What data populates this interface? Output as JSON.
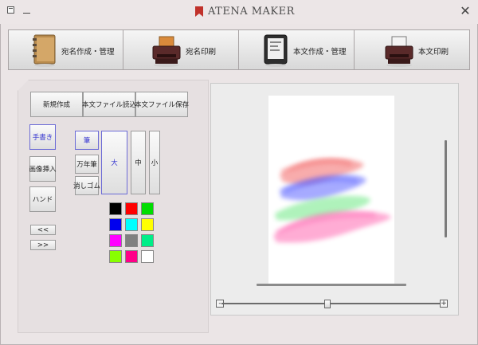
{
  "app": {
    "title": "ATENA MAKER",
    "close_glyph": "✕"
  },
  "top_tabs": [
    {
      "label": "宛名作成・管理",
      "icon": "address-book-icon"
    },
    {
      "label": "宛名印刷",
      "icon": "printer-icon"
    },
    {
      "label": "本文作成・管理",
      "icon": "tablet-document-icon"
    },
    {
      "label": "本文印刷",
      "icon": "printer-icon"
    }
  ],
  "file_buttons": {
    "new": "新規作成",
    "load": "本文ファイル読込",
    "save": "本文ファイル保存"
  },
  "mode_buttons": {
    "handwriting": "手書き",
    "insert_image": "画像挿入",
    "hand": "ハンド"
  },
  "nav_buttons": {
    "prev": "<<",
    "next": ">>"
  },
  "tools": {
    "brush": "筆",
    "pen": "万年筆",
    "eraser": "消しゴム"
  },
  "sizes": {
    "large": "大",
    "medium": "中",
    "small": "小"
  },
  "selected": {
    "mode": "手書き",
    "tool": "筆",
    "size": "大"
  },
  "palette": [
    "#000000",
    "#ff0000",
    "#00dd00",
    "#0000ee",
    "#00ffff",
    "#ffff00",
    "#ff00ff",
    "#808080",
    "#00ee88",
    "#88ff00",
    "#ff0088",
    "#ffffff"
  ],
  "zoom": {
    "minus": "-",
    "plus": "+",
    "value": 0.48
  },
  "colors": {
    "selected_border": "#6b6bd6",
    "selected_text": "#3434d0",
    "stroke_red": "#f04848",
    "stroke_blue": "#3b44ff",
    "stroke_green": "#4fe36a",
    "stroke_pink": "#ff4aa2"
  }
}
